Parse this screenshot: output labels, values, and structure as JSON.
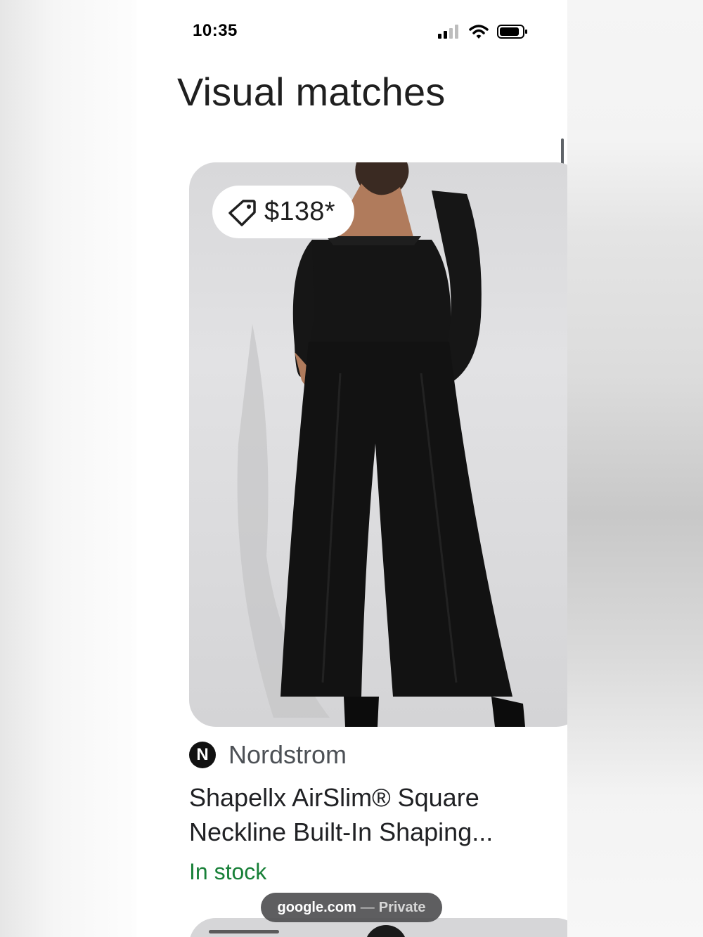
{
  "status_bar": {
    "time": "10:35",
    "icons": [
      "cellular-signal-icon",
      "wifi-icon",
      "battery-icon"
    ]
  },
  "page": {
    "title": "Visual matches"
  },
  "result": {
    "price": "$138*",
    "price_icon": "price-tag-icon",
    "merchant_initial": "N",
    "merchant": "Nordstrom",
    "title": "Shapellx AirSlim® Square Neckline Built-In Shaping...",
    "availability": "In stock",
    "availability_color": "#188038"
  },
  "browser": {
    "domain": "google.com",
    "separator": "—",
    "mode": "Private"
  }
}
